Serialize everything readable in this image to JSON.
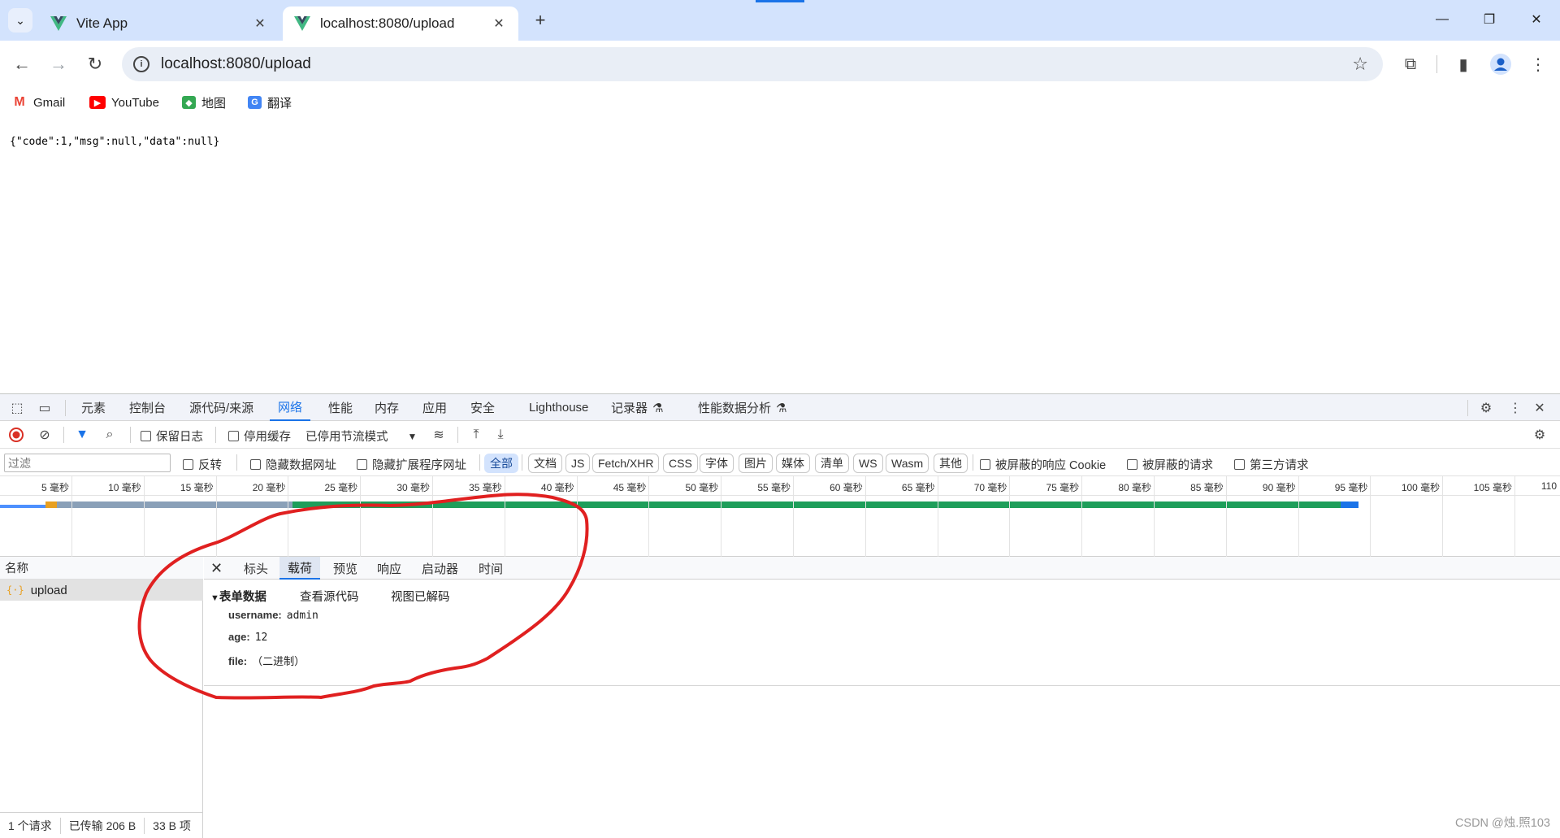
{
  "browser": {
    "tabs": [
      {
        "title": "Vite App",
        "icon": "vue-logo-icon"
      },
      {
        "title": "localhost:8080/upload",
        "icon": "vue-logo-icon"
      }
    ],
    "address": "localhost:8080/upload",
    "bookmarks": [
      {
        "label": "Gmail",
        "icon": "gmail-icon",
        "color": "#ea4335"
      },
      {
        "label": "YouTube",
        "icon": "youtube-icon",
        "color": "#ff0000"
      },
      {
        "label": "地图",
        "icon": "maps-icon",
        "color": "#34a853"
      },
      {
        "label": "翻译",
        "icon": "translate-icon",
        "color": "#4285f4"
      }
    ]
  },
  "page": {
    "body_text": "{\"code\":1,\"msg\":null,\"data\":null}"
  },
  "devtools": {
    "tabs": [
      "元素",
      "控制台",
      "源代码/来源",
      "网络",
      "性能",
      "内存",
      "应用",
      "安全",
      "Lighthouse",
      "记录器",
      "性能数据分析"
    ],
    "active_tab": "网络",
    "toolbar": {
      "preserve_log": "保留日志",
      "disable_cache": "停用缓存",
      "throttle": "已停用节流模式"
    },
    "filter": {
      "placeholder": "过滤",
      "invert": "反转",
      "hide_data_urls": "隐藏数据网址",
      "hide_ext_urls": "隐藏扩展程序网址",
      "types": [
        "全部",
        "文档",
        "JS",
        "Fetch/XHR",
        "CSS",
        "字体",
        "图片",
        "媒体",
        "清单",
        "WS",
        "Wasm",
        "其他"
      ],
      "selected_type": "全部",
      "blocked_cookies": "被屏蔽的响应 Cookie",
      "blocked_requests": "被屏蔽的请求",
      "third_party": "第三方请求"
    },
    "timeline_labels": [
      "5 毫秒",
      "10 毫秒",
      "15 毫秒",
      "20 毫秒",
      "25 毫秒",
      "30 毫秒",
      "35 毫秒",
      "40 毫秒",
      "45 毫秒",
      "50 毫秒",
      "55 毫秒",
      "60 毫秒",
      "65 毫秒",
      "70 毫秒",
      "75 毫秒",
      "80 毫秒",
      "85 毫秒",
      "90 毫秒",
      "95 毫秒",
      "100 毫秒",
      "105 毫秒",
      "110"
    ],
    "names_header": "名称",
    "requests": [
      {
        "name": "upload"
      }
    ],
    "detail_tabs": [
      "标头",
      "载荷",
      "预览",
      "响应",
      "启动器",
      "时间"
    ],
    "active_detail_tab": "载荷",
    "payload": {
      "section_title": "表单数据",
      "view_source": "查看源代码",
      "view_decoded": "视图已解码",
      "fields": [
        {
          "key": "username:",
          "value": "admin"
        },
        {
          "key": "age:",
          "value": "12"
        },
        {
          "key": "file:",
          "value": "（二进制）"
        }
      ]
    },
    "status": {
      "requests": "1 个请求",
      "transferred": "已传输 206 B",
      "resources": "33 B 项"
    }
  },
  "watermark": "CSDN @烛.照103",
  "colors": {
    "accent": "#1a73e8",
    "tabstrip": "#d3e3fd",
    "annotation": "#e02020"
  }
}
